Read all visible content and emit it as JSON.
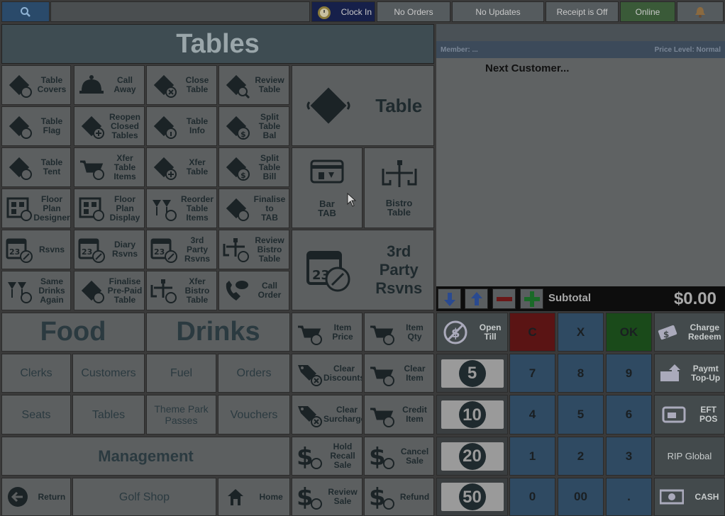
{
  "topbar": {
    "clock_in": "Clock In",
    "no_orders": "No Orders",
    "no_updates": "No Updates",
    "receipt": "Receipt is Off",
    "online": "Online"
  },
  "header": {
    "title": "Tables"
  },
  "grid": {
    "table_covers": "Table\nCovers",
    "call_away": "Call\nAway",
    "close_table": "Close\nTable",
    "review_table": "Review\nTable",
    "table_flag": "Table\nFlag",
    "reopen_closed": "Reopen\nClosed\nTables",
    "table_info": "Table\nInfo",
    "split_table_bal": "Split\nTable\nBal",
    "table_tent": "Table\nTent",
    "xfer_table_items": "Xfer\nTable\nItems",
    "xfer_table": "Xfer\nTable",
    "split_table_bill": "Split\nTable\nBill",
    "floor_plan_designer": "Floor\nPlan\nDesigner",
    "floor_plan_display": "Floor\nPlan\nDisplay",
    "reorder_table_items": "Reorder\nTable\nItems",
    "finalise_to_tab": "Finalise\nto\nTAB",
    "rsvns": "Rsvns",
    "diary_rsvns": "Diary\nRsvns",
    "third_party_rsvns_small": "3rd\nParty\nRsvns",
    "review_bistro_table": "Review\nBistro\nTable",
    "same_drinks_again": "Same\nDrinks\nAgain",
    "finalise_prepaid": "Finalise\nPre-Paid\nTable",
    "xfer_bistro_table": "Xfer\nBistro\nTable",
    "call_order": "Call\nOrder",
    "table_big": "Table",
    "bar_tab": "Bar\nTAB",
    "bistro_table": "Bistro\nTable",
    "third_party_rsvns_big": "3rd\nParty\nRsvns"
  },
  "lower": {
    "food": "Food",
    "drinks": "Drinks",
    "item_price": "Item\nPrice",
    "item_qty": "Item\nQty",
    "clerks": "Clerks",
    "customers": "Customers",
    "fuel": "Fuel",
    "orders": "Orders",
    "clear_discounts": "Clear\nDiscounts",
    "clear_item": "Clear\nItem",
    "seats": "Seats",
    "tables": "Tables",
    "theme_park": "Theme Park\nPasses",
    "vouchers": "Vouchers",
    "clear_surcharges": "Clear\nSurcharges",
    "credit_item": "Credit\nItem",
    "management": "Management",
    "hold_recall_sale": "Hold\nRecall\nSale",
    "cancel_sale": "Cancel\nSale",
    "return": "Return",
    "golf_shop": "Golf Shop",
    "home": "Home",
    "review_sale": "Review\nSale",
    "refund": "Refund"
  },
  "receipt": {
    "member": "Member: ...",
    "price_level": "Price Level: Normal",
    "next_customer": "Next Customer...",
    "subtotal_label": "Subtotal",
    "subtotal_value": "$0.00"
  },
  "keypad": {
    "open_till": "Open\nTill",
    "c": "C",
    "x": "X",
    "ok": "OK",
    "charge_redeem": "Charge\nRedeem",
    "note5": "5",
    "note10": "10",
    "note20": "20",
    "note50": "50",
    "k7": "7",
    "k8": "8",
    "k9": "9",
    "k4": "4",
    "k5": "5",
    "k6": "6",
    "k1": "1",
    "k2": "2",
    "k3": "3",
    "k0": "0",
    "k00": "00",
    "kdot": ".",
    "paymt_topup": "Paymt\nTop-Up",
    "eft_pos": "EFT\nPOS",
    "rip_global": "RIP Global",
    "cash": "CASH"
  }
}
